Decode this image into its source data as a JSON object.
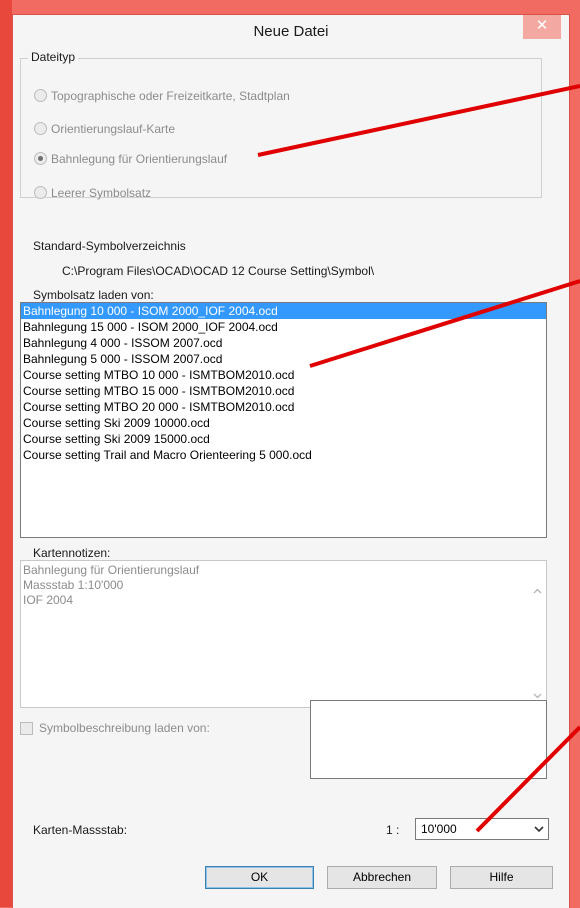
{
  "dialog": {
    "title": "Neue Datei",
    "close_label": "✕"
  },
  "file_type": {
    "legend": "Dateityp",
    "options": [
      {
        "label": "Topographische oder Freizeitkarte, Stadtplan",
        "checked": false
      },
      {
        "label": "Orientierungslauf-Karte",
        "checked": false
      },
      {
        "label": "Bahnlegung für Orientierungslauf",
        "checked": true
      },
      {
        "label": "Leerer Symbolsatz",
        "checked": false
      }
    ]
  },
  "standard_dir": {
    "label": "Standard-Symbolverzeichnis",
    "path": "C:\\Program Files\\OCAD\\OCAD 12 Course Setting\\Symbol\\"
  },
  "symbol_set": {
    "label": "Symbolsatz laden von:",
    "items": [
      "Bahnlegung 10 000 - ISOM 2000_IOF 2004.ocd",
      "Bahnlegung 15 000 - ISOM 2000_IOF 2004.ocd",
      "Bahnlegung 4 000 - ISSOM 2007.ocd",
      "Bahnlegung 5 000 - ISSOM 2007.ocd",
      "Course setting MTBO 10 000 - ISMTBOM2010.ocd",
      "Course setting MTBO 15 000 - ISMTBOM2010.ocd",
      "Course setting MTBO 20 000 - ISMTBOM2010.ocd",
      "Course setting Ski 2009 10000.ocd",
      "Course setting Ski 2009 15000.ocd",
      "Course setting Trail and Macro Orienteering 5 000.ocd"
    ],
    "selected_index": 0
  },
  "notes": {
    "label": "Kartennotizen:",
    "lines": [
      "Bahnlegung für Orientierungslauf",
      "Massstab 1:10'000",
      "IOF 2004"
    ]
  },
  "symbol_description": {
    "label": "Symbolbeschreibung laden von:"
  },
  "scale": {
    "label": "Karten-Massstab:",
    "prefix": "1 :",
    "value": "10'000"
  },
  "buttons": {
    "ok": "OK",
    "cancel": "Abbrechen",
    "help": "Hilfe"
  },
  "colors": {
    "background": "#f26b62",
    "annotation_line": "#e00000",
    "selection": "#3399ff"
  }
}
